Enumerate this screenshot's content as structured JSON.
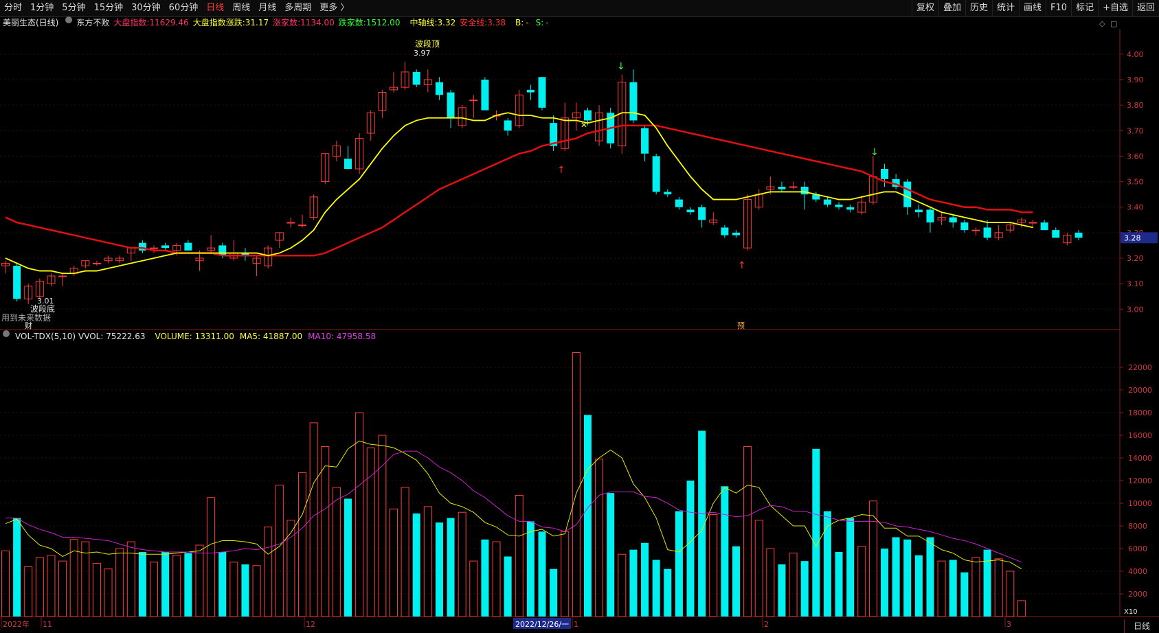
{
  "toolbar": {
    "periods": [
      {
        "label": "分时"
      },
      {
        "label": "1分钟"
      },
      {
        "label": "5分钟"
      },
      {
        "label": "15分钟"
      },
      {
        "label": "30分钟"
      },
      {
        "label": "60分钟"
      },
      {
        "label": "日线",
        "active": true
      },
      {
        "label": "周线"
      },
      {
        "label": "月线"
      },
      {
        "label": "多周期"
      },
      {
        "label": "更多 〉"
      }
    ],
    "right": [
      {
        "label": "复权"
      },
      {
        "label": "叠加"
      },
      {
        "label": "历史"
      },
      {
        "label": "统计"
      },
      {
        "label": "画线"
      },
      {
        "label": "F10"
      },
      {
        "label": "标记"
      },
      {
        "label": "+自选"
      },
      {
        "label": "返回"
      }
    ]
  },
  "info": {
    "stock": "美丽生态(日线)",
    "indicator_name": "东方不败",
    "dapan_label": "大盘指数:",
    "dapan_value": "11629.46",
    "dapan_change_label": "大盘指数涨跌:",
    "dapan_change_value": "31.17",
    "up_label": "涨家数:",
    "up_value": "1134.00",
    "down_label": "跌家数:",
    "down_value": "1512.00",
    "mid_label": "中轴线:",
    "mid_value": "3.32",
    "safe_label": "安全线:",
    "safe_value": "3.38",
    "b_label": "B:",
    "b_value": "-",
    "s_label": "S:",
    "s_value": "-"
  },
  "vol_info": {
    "name": "VOL-TDX(5,10)",
    "vvol": "VVOL: 75222.63",
    "volume": "VOLUME: 13311.00",
    "ma5": "MA5: 41887.00",
    "ma10": "MA10: 47958.58"
  },
  "annotations": {
    "peak_label": "波段顶",
    "peak_value": "3.97",
    "trough_label": "波段底",
    "trough_value": "3.01",
    "future_note": "用到未来数据",
    "cai": "财",
    "yu": "预",
    "current_price": "3.28",
    "x10": "X10"
  },
  "dates": [
    "2022年",
    "11",
    "12",
    "2022/12/26/一",
    "1",
    "2",
    "3"
  ],
  "bottom_right": "日线",
  "colors": {
    "up": "#ff3c3c",
    "down": "#00f0f0",
    "ma_yellow": "#ffff00",
    "ma_red": "#e01010",
    "vol_ma5": "#e6e600",
    "vol_ma10": "#d020d0"
  },
  "chart_data": {
    "type": "candlestick",
    "price_axis": [
      4.0,
      3.9,
      3.8,
      3.7,
      3.6,
      3.5,
      3.4,
      3.3,
      3.2,
      3.1,
      3.0
    ],
    "volume_axis": [
      22000,
      20000,
      18000,
      16000,
      14000,
      12000,
      10000,
      8000,
      6000,
      4000,
      2000
    ],
    "price_range": [
      2.92,
      4.04
    ],
    "volume_range": [
      0,
      24000
    ],
    "candles": [
      {
        "o": 3.17,
        "h": 3.19,
        "l": 3.14,
        "c": 3.18
      },
      {
        "o": 3.17,
        "h": 3.18,
        "l": 3.03,
        "c": 3.04
      },
      {
        "o": 3.04,
        "h": 3.1,
        "l": 3.02,
        "c": 3.09
      },
      {
        "o": 3.05,
        "h": 3.12,
        "l": 3.04,
        "c": 3.11
      },
      {
        "o": 3.1,
        "h": 3.14,
        "l": 3.09,
        "c": 3.13
      },
      {
        "o": 3.13,
        "h": 3.14,
        "l": 3.09,
        "c": 3.13
      },
      {
        "o": 3.14,
        "h": 3.17,
        "l": 3.13,
        "c": 3.16
      },
      {
        "o": 3.17,
        "h": 3.19,
        "l": 3.16,
        "c": 3.19
      },
      {
        "o": 3.18,
        "h": 3.19,
        "l": 3.17,
        "c": 3.18
      },
      {
        "o": 3.19,
        "h": 3.21,
        "l": 3.18,
        "c": 3.2
      },
      {
        "o": 3.19,
        "h": 3.21,
        "l": 3.18,
        "c": 3.2
      },
      {
        "o": 3.22,
        "h": 3.24,
        "l": 3.19,
        "c": 3.24
      },
      {
        "o": 3.26,
        "h": 3.27,
        "l": 3.22,
        "c": 3.23
      },
      {
        "o": 3.24,
        "h": 3.25,
        "l": 3.22,
        "c": 3.24
      },
      {
        "o": 3.25,
        "h": 3.26,
        "l": 3.23,
        "c": 3.24
      },
      {
        "o": 3.23,
        "h": 3.26,
        "l": 3.21,
        "c": 3.25
      },
      {
        "o": 3.26,
        "h": 3.27,
        "l": 3.23,
        "c": 3.23
      },
      {
        "o": 3.19,
        "h": 3.23,
        "l": 3.15,
        "c": 3.2
      },
      {
        "o": 3.23,
        "h": 3.29,
        "l": 3.22,
        "c": 3.24
      },
      {
        "o": 3.25,
        "h": 3.26,
        "l": 3.2,
        "c": 3.21
      },
      {
        "o": 3.2,
        "h": 3.27,
        "l": 3.19,
        "c": 3.22
      },
      {
        "o": 3.22,
        "h": 3.24,
        "l": 3.19,
        "c": 3.21
      },
      {
        "o": 3.18,
        "h": 3.21,
        "l": 3.13,
        "c": 3.2
      },
      {
        "o": 3.17,
        "h": 3.25,
        "l": 3.16,
        "c": 3.24
      },
      {
        "o": 3.27,
        "h": 3.3,
        "l": 3.24,
        "c": 3.3
      },
      {
        "o": 3.34,
        "h": 3.36,
        "l": 3.32,
        "c": 3.34
      },
      {
        "o": 3.33,
        "h": 3.37,
        "l": 3.32,
        "c": 3.33
      },
      {
        "o": 3.36,
        "h": 3.45,
        "l": 3.35,
        "c": 3.44
      },
      {
        "o": 3.5,
        "h": 3.61,
        "l": 3.49,
        "c": 3.61
      },
      {
        "o": 3.6,
        "h": 3.66,
        "l": 3.58,
        "c": 3.64
      },
      {
        "o": 3.59,
        "h": 3.64,
        "l": 3.56,
        "c": 3.55
      },
      {
        "o": 3.55,
        "h": 3.69,
        "l": 3.53,
        "c": 3.67
      },
      {
        "o": 3.69,
        "h": 3.78,
        "l": 3.66,
        "c": 3.77
      },
      {
        "o": 3.78,
        "h": 3.86,
        "l": 3.75,
        "c": 3.85
      },
      {
        "o": 3.86,
        "h": 3.93,
        "l": 3.85,
        "c": 3.87
      },
      {
        "o": 3.87,
        "h": 3.97,
        "l": 3.86,
        "c": 3.93
      },
      {
        "o": 3.93,
        "h": 3.94,
        "l": 3.87,
        "c": 3.88
      },
      {
        "o": 3.88,
        "h": 3.94,
        "l": 3.85,
        "c": 3.9
      },
      {
        "o": 3.89,
        "h": 3.91,
        "l": 3.82,
        "c": 3.84
      },
      {
        "o": 3.85,
        "h": 3.86,
        "l": 3.71,
        "c": 3.75
      },
      {
        "o": 3.72,
        "h": 3.8,
        "l": 3.71,
        "c": 3.79
      },
      {
        "o": 3.82,
        "h": 3.84,
        "l": 3.75,
        "c": 3.82
      },
      {
        "o": 3.9,
        "h": 3.91,
        "l": 3.78,
        "c": 3.78
      },
      {
        "o": 3.76,
        "h": 3.78,
        "l": 3.74,
        "c": 3.76
      },
      {
        "o": 3.74,
        "h": 3.75,
        "l": 3.68,
        "c": 3.7
      },
      {
        "o": 3.72,
        "h": 3.86,
        "l": 3.71,
        "c": 3.84
      },
      {
        "o": 3.86,
        "h": 3.88,
        "l": 3.82,
        "c": 3.85
      },
      {
        "o": 3.91,
        "h": 3.91,
        "l": 3.78,
        "c": 3.79
      },
      {
        "o": 3.73,
        "h": 3.76,
        "l": 3.62,
        "c": 3.64
      },
      {
        "o": 3.63,
        "h": 3.81,
        "l": 3.62,
        "c": 3.75
      },
      {
        "o": 3.75,
        "h": 3.81,
        "l": 3.7,
        "c": 3.77
      },
      {
        "o": 3.78,
        "h": 3.79,
        "l": 3.72,
        "c": 3.74
      },
      {
        "o": 3.66,
        "h": 3.8,
        "l": 3.64,
        "c": 3.77
      },
      {
        "o": 3.77,
        "h": 3.79,
        "l": 3.63,
        "c": 3.65
      },
      {
        "o": 3.64,
        "h": 3.92,
        "l": 3.61,
        "c": 3.89
      },
      {
        "o": 3.89,
        "h": 3.94,
        "l": 3.73,
        "c": 3.74
      },
      {
        "o": 3.71,
        "h": 3.72,
        "l": 3.58,
        "c": 3.61
      },
      {
        "o": 3.6,
        "h": 3.61,
        "l": 3.45,
        "c": 3.46
      },
      {
        "o": 3.46,
        "h": 3.47,
        "l": 3.44,
        "c": 3.45
      },
      {
        "o": 3.43,
        "h": 3.44,
        "l": 3.39,
        "c": 3.4
      },
      {
        "o": 3.39,
        "h": 3.4,
        "l": 3.37,
        "c": 3.38
      },
      {
        "o": 3.4,
        "h": 3.41,
        "l": 3.32,
        "c": 3.35
      },
      {
        "o": 3.34,
        "h": 3.38,
        "l": 3.33,
        "c": 3.35
      },
      {
        "o": 3.32,
        "h": 3.33,
        "l": 3.28,
        "c": 3.29
      },
      {
        "o": 3.3,
        "h": 3.31,
        "l": 3.28,
        "c": 3.29
      },
      {
        "o": 3.24,
        "h": 3.45,
        "l": 3.23,
        "c": 3.43
      },
      {
        "o": 3.4,
        "h": 3.47,
        "l": 3.39,
        "c": 3.45
      },
      {
        "o": 3.47,
        "h": 3.52,
        "l": 3.45,
        "c": 3.48
      },
      {
        "o": 3.48,
        "h": 3.5,
        "l": 3.46,
        "c": 3.47
      },
      {
        "o": 3.48,
        "h": 3.5,
        "l": 3.47,
        "c": 3.48
      },
      {
        "o": 3.48,
        "h": 3.5,
        "l": 3.39,
        "c": 3.45
      },
      {
        "o": 3.45,
        "h": 3.46,
        "l": 3.42,
        "c": 3.43
      },
      {
        "o": 3.43,
        "h": 3.44,
        "l": 3.4,
        "c": 3.41
      },
      {
        "o": 3.41,
        "h": 3.42,
        "l": 3.39,
        "c": 3.4
      },
      {
        "o": 3.4,
        "h": 3.41,
        "l": 3.38,
        "c": 3.39
      },
      {
        "o": 3.38,
        "h": 3.44,
        "l": 3.37,
        "c": 3.42
      },
      {
        "o": 3.42,
        "h": 3.6,
        "l": 3.41,
        "c": 3.52
      },
      {
        "o": 3.55,
        "h": 3.57,
        "l": 3.48,
        "c": 3.51
      },
      {
        "o": 3.51,
        "h": 3.53,
        "l": 3.47,
        "c": 3.48
      },
      {
        "o": 3.5,
        "h": 3.51,
        "l": 3.37,
        "c": 3.4
      },
      {
        "o": 3.39,
        "h": 3.41,
        "l": 3.36,
        "c": 3.38
      },
      {
        "o": 3.39,
        "h": 3.4,
        "l": 3.3,
        "c": 3.34
      },
      {
        "o": 3.35,
        "h": 3.38,
        "l": 3.33,
        "c": 3.36
      },
      {
        "o": 3.36,
        "h": 3.37,
        "l": 3.32,
        "c": 3.34
      },
      {
        "o": 3.34,
        "h": 3.35,
        "l": 3.3,
        "c": 3.31
      },
      {
        "o": 3.31,
        "h": 3.32,
        "l": 3.29,
        "c": 3.31
      },
      {
        "o": 3.32,
        "h": 3.35,
        "l": 3.27,
        "c": 3.28
      },
      {
        "o": 3.28,
        "h": 3.33,
        "l": 3.27,
        "c": 3.3
      },
      {
        "o": 3.31,
        "h": 3.34,
        "l": 3.3,
        "c": 3.33
      },
      {
        "o": 3.34,
        "h": 3.36,
        "l": 3.32,
        "c": 3.35
      },
      {
        "o": 3.34,
        "h": 3.35,
        "l": 3.32,
        "c": 3.34
      },
      {
        "o": 3.34,
        "h": 3.35,
        "l": 3.31,
        "c": 3.31
      },
      {
        "o": 3.31,
        "h": 3.32,
        "l": 3.28,
        "c": 3.28
      },
      {
        "o": 3.26,
        "h": 3.3,
        "l": 3.25,
        "c": 3.29
      },
      {
        "o": 3.3,
        "h": 3.31,
        "l": 3.27,
        "c": 3.28
      }
    ],
    "volumes": [
      5800,
      8700,
      4400,
      5200,
      5400,
      4900,
      6800,
      6600,
      4700,
      4200,
      6000,
      6600,
      5700,
      4800,
      5700,
      5400,
      5600,
      6300,
      10500,
      5700,
      4800,
      4600,
      4500,
      7900,
      11600,
      8500,
      12700,
      17100,
      15000,
      11400,
      10400,
      18000,
      14900,
      16000,
      9500,
      11400,
      9100,
      9700,
      8300,
      8700,
      9200,
      4900,
      6800,
      6600,
      5300,
      10700,
      8400,
      7500,
      4200,
      7500,
      23300,
      17800,
      13900,
      10900,
      5500,
      5900,
      6500,
      5000,
      4200,
      9300,
      12000,
      16400,
      9000,
      11500,
      6200,
      15000,
      8500,
      6000,
      4600,
      5600,
      4900,
      14800,
      9300,
      5700,
      8700,
      6200,
      10200,
      6000,
      7000,
      6800,
      5400,
      7000,
      4900,
      5000,
      3900,
      5200,
      5900,
      5100,
      4000,
      1400
    ],
    "ma_yellow_price": [
      3.2,
      3.18,
      3.16,
      3.15,
      3.15,
      3.14,
      3.14,
      3.15,
      3.15,
      3.16,
      3.17,
      3.18,
      3.19,
      3.2,
      3.21,
      3.22,
      3.22,
      3.22,
      3.22,
      3.22,
      3.22,
      3.22,
      3.22,
      3.21,
      3.22,
      3.24,
      3.27,
      3.31,
      3.38,
      3.43,
      3.47,
      3.51,
      3.57,
      3.63,
      3.68,
      3.72,
      3.74,
      3.75,
      3.75,
      3.75,
      3.75,
      3.74,
      3.74,
      3.76,
      3.77,
      3.76,
      3.76,
      3.75,
      3.75,
      3.74,
      3.74,
      3.73,
      3.74,
      3.75,
      3.77,
      3.77,
      3.76,
      3.71,
      3.64,
      3.58,
      3.52,
      3.47,
      3.43,
      3.43,
      3.43,
      3.44,
      3.45,
      3.46,
      3.46,
      3.46,
      3.46,
      3.45,
      3.44,
      3.43,
      3.43,
      3.44,
      3.45,
      3.46,
      3.46,
      3.44,
      3.42,
      3.4,
      3.38,
      3.37,
      3.36,
      3.35,
      3.34,
      3.34,
      3.34,
      3.33,
      3.32
    ],
    "ma_red_price": [
      3.36,
      3.34,
      3.33,
      3.32,
      3.31,
      3.3,
      3.29,
      3.28,
      3.27,
      3.26,
      3.25,
      3.24,
      3.24,
      3.23,
      3.23,
      3.22,
      3.22,
      3.22,
      3.22,
      3.21,
      3.21,
      3.21,
      3.21,
      3.21,
      3.21,
      3.21,
      3.21,
      3.21,
      3.22,
      3.24,
      3.26,
      3.28,
      3.3,
      3.32,
      3.35,
      3.38,
      3.41,
      3.44,
      3.47,
      3.49,
      3.51,
      3.53,
      3.55,
      3.57,
      3.59,
      3.61,
      3.62,
      3.64,
      3.65,
      3.66,
      3.67,
      3.69,
      3.7,
      3.71,
      3.72,
      3.72,
      3.72,
      3.72,
      3.71,
      3.7,
      3.69,
      3.68,
      3.67,
      3.66,
      3.65,
      3.64,
      3.63,
      3.62,
      3.61,
      3.6,
      3.59,
      3.58,
      3.57,
      3.56,
      3.55,
      3.54,
      3.52,
      3.5,
      3.49,
      3.47,
      3.45,
      3.43,
      3.42,
      3.41,
      3.4,
      3.4,
      3.39,
      3.39,
      3.39,
      3.38,
      3.38
    ],
    "vol_ma5": [
      8200,
      8600,
      7200,
      6300,
      6000,
      5300,
      5800,
      5600,
      5700,
      5500,
      5600,
      5600,
      5500,
      5500,
      5500,
      5600,
      5700,
      5800,
      6400,
      6700,
      6700,
      6600,
      6400,
      5500,
      6200,
      7400,
      9000,
      11800,
      13300,
      13200,
      14800,
      15500,
      15200,
      15100,
      14900,
      14400,
      13800,
      12600,
      10900,
      10000,
      9700,
      9200,
      8300,
      7900,
      7200,
      7100,
      7500,
      7700,
      7100,
      7300,
      10900,
      13000,
      14000,
      14700,
      14000,
      11700,
      10500,
      8700,
      5900,
      5700,
      6600,
      7600,
      10000,
      11400,
      10900,
      11600,
      11400,
      9800,
      8900,
      8000,
      8000,
      6200,
      8000,
      8500,
      8700,
      9000,
      8900,
      7800,
      7800,
      7100,
      7100,
      6500,
      5900,
      5600,
      5000,
      4800,
      4900,
      5000,
      4800,
      4200
    ],
    "vol_ma10": [
      8700,
      8700,
      8100,
      7700,
      7400,
      7000,
      7000,
      6900,
      6800,
      6700,
      6400,
      6100,
      5900,
      5800,
      5700,
      5700,
      5700,
      5600,
      5600,
      5700,
      5800,
      6000,
      5900,
      6100,
      6400,
      7000,
      7800,
      8900,
      9500,
      10300,
      10800,
      11600,
      12400,
      13300,
      14300,
      14600,
      14600,
      14000,
      13200,
      12700,
      12000,
      11100,
      10500,
      9700,
      8900,
      8400,
      8400,
      7900,
      7800,
      7500,
      8100,
      9600,
      10700,
      11000,
      11000,
      11000,
      10600,
      10500,
      10000,
      9400,
      9200,
      9100,
      9200,
      9000,
      8800,
      8900,
      9400,
      9800,
      9700,
      9300,
      9300,
      9000,
      8800,
      8500,
      8400,
      8400,
      8400,
      8300,
      8000,
      7900,
      7700,
      7500,
      7200,
      6900,
      6700,
      6400,
      6000,
      5600,
      5200,
      4800
    ]
  }
}
